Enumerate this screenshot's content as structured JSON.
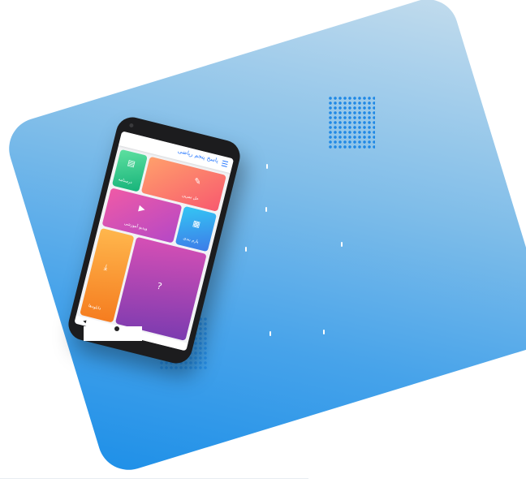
{
  "app": {
    "title": "پاسخ پنجم ریاضی",
    "tiles": [
      {
        "id": "green",
        "label": "درسنامه",
        "icon": "book-icon",
        "color": "#17b37a"
      },
      {
        "id": "orange1",
        "label": "حل تمرین",
        "icon": "edit-icon",
        "color": "#f85a6f"
      },
      {
        "id": "pink",
        "label": "ویدیو آموزشی",
        "icon": "play-icon",
        "color": "#b548c6"
      },
      {
        "id": "blue",
        "label": "پارم بندی",
        "icon": "grid-icon",
        "color": "#3d7be8"
      },
      {
        "id": "orange2",
        "label": "دانلودها",
        "icon": "download-icon",
        "color": "#f57c1f"
      },
      {
        "id": "purple",
        "label": "",
        "icon": "help-icon",
        "color": "#7b3bb0"
      }
    ]
  },
  "colors": {
    "accent": "#2979ff",
    "card_gradient_end": "#1d8fe8"
  }
}
